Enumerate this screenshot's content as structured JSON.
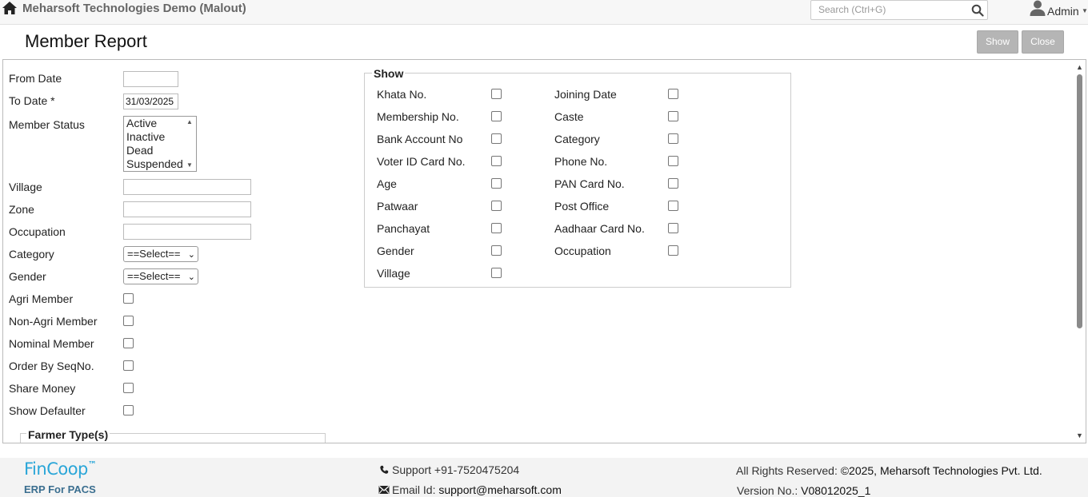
{
  "header": {
    "app_title": "Meharsoft Technologies Demo (Malout)",
    "search_placeholder": "Search (Ctrl+G)",
    "user_label": "Admin",
    "icons": {
      "home": "home-icon",
      "search": "search-icon",
      "user": "user-icon"
    }
  },
  "page": {
    "title": "Member Report",
    "show_button": "Show",
    "close_button": "Close"
  },
  "form": {
    "from_date_label": "From Date",
    "from_date_value": "",
    "to_date_label": "To Date *",
    "to_date_value": "31/03/2025",
    "member_status_label": "Member Status",
    "member_status_options": [
      "Active",
      "Inactive",
      "Dead",
      "Suspended"
    ],
    "village_label": "Village",
    "zone_label": "Zone",
    "occupation_label": "Occupation",
    "category_label": "Category",
    "category_value": "==Select==",
    "gender_label": "Gender",
    "gender_value": "==Select==",
    "agri_member_label": "Agri Member",
    "non_agri_member_label": "Non-Agri Member",
    "nominal_member_label": "Nominal Member",
    "order_by_seqno_label": "Order By SeqNo.",
    "share_money_label": "Share Money",
    "show_defaulter_label": "Show Defaulter",
    "farmer_types_legend": "Farmer Type(s)"
  },
  "show_group": {
    "legend": "Show",
    "left_column": [
      "Khata No.",
      "Membership No.",
      "Bank Account No",
      "Voter ID Card No.",
      "Age",
      "Patwaar",
      "Panchayat",
      "Gender",
      "Village"
    ],
    "right_column": [
      "Joining Date",
      "Caste",
      "Category",
      "Phone No.",
      "PAN Card No.",
      "Post Office",
      "Aadhaar Card No.",
      "Occupation"
    ]
  },
  "footer": {
    "logo_text": "FinCoop",
    "logo_tm": "™",
    "tagline": "ERP For PACS",
    "support_text": "Support +91-7520475204",
    "email_label": "Email Id:",
    "email_value": "support@meharsoft.com",
    "rights_label": "All Rights Reserved:",
    "rights_value": "©2025, Meharsoft Technologies Pvt. Ltd.",
    "version_label": "Version No.:",
    "version_value": "V08012025_1"
  },
  "colors": {
    "logo": "#2aa6d8",
    "tagline": "#3a6e8f",
    "button_bg": "#b5b5b5"
  }
}
